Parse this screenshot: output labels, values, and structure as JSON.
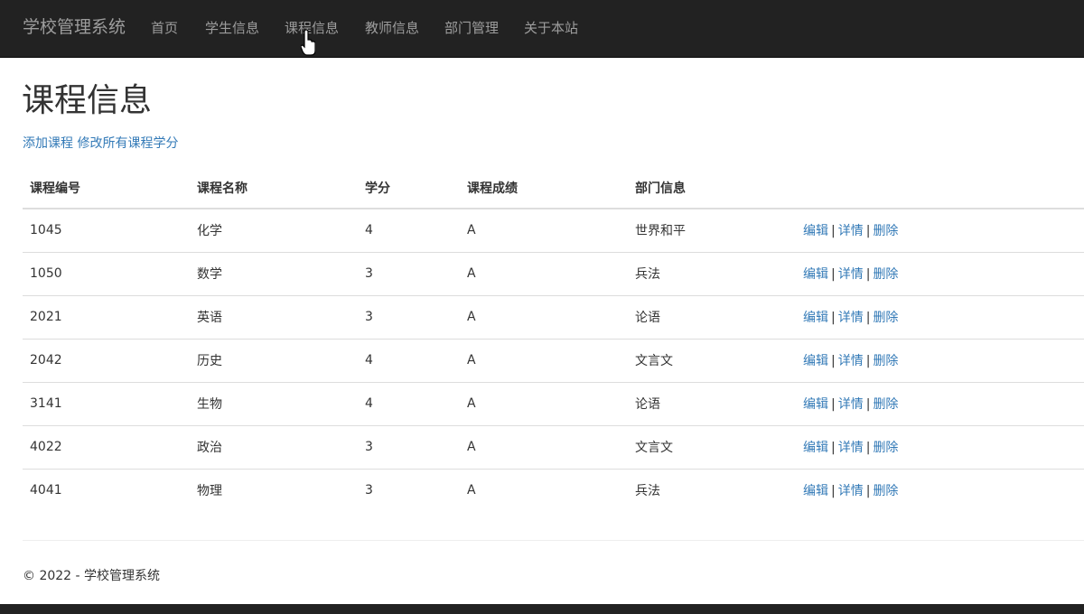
{
  "nav": {
    "brand": "学校管理系统",
    "items": [
      "首页",
      "学生信息",
      "课程信息",
      "教师信息",
      "部门管理",
      "关于本站"
    ]
  },
  "page": {
    "title": "课程信息",
    "add_course": "添加课程",
    "edit_all_credits": "修改所有课程学分"
  },
  "table": {
    "headers": [
      "课程编号",
      "课程名称",
      "学分",
      "课程成绩",
      "部门信息"
    ],
    "rows": [
      [
        "1045",
        "化学",
        "4",
        "A",
        "世界和平"
      ],
      [
        "1050",
        "数学",
        "3",
        "A",
        "兵法"
      ],
      [
        "2021",
        "英语",
        "3",
        "A",
        "论语"
      ],
      [
        "2042",
        "历史",
        "4",
        "A",
        "文言文"
      ],
      [
        "3141",
        "生物",
        "4",
        "A",
        "论语"
      ],
      [
        "4022",
        "政治",
        "3",
        "A",
        "文言文"
      ],
      [
        "4041",
        "物理",
        "3",
        "A",
        "兵法"
      ]
    ],
    "actions": {
      "edit": "编辑",
      "details": "详情",
      "delete": "删除",
      "separator": "|"
    }
  },
  "footer": {
    "text": "© 2022 - 学校管理系统"
  },
  "colors": {
    "navbar": "#222222",
    "nav_text": "#9d9d9d",
    "link": "#337ab7"
  }
}
